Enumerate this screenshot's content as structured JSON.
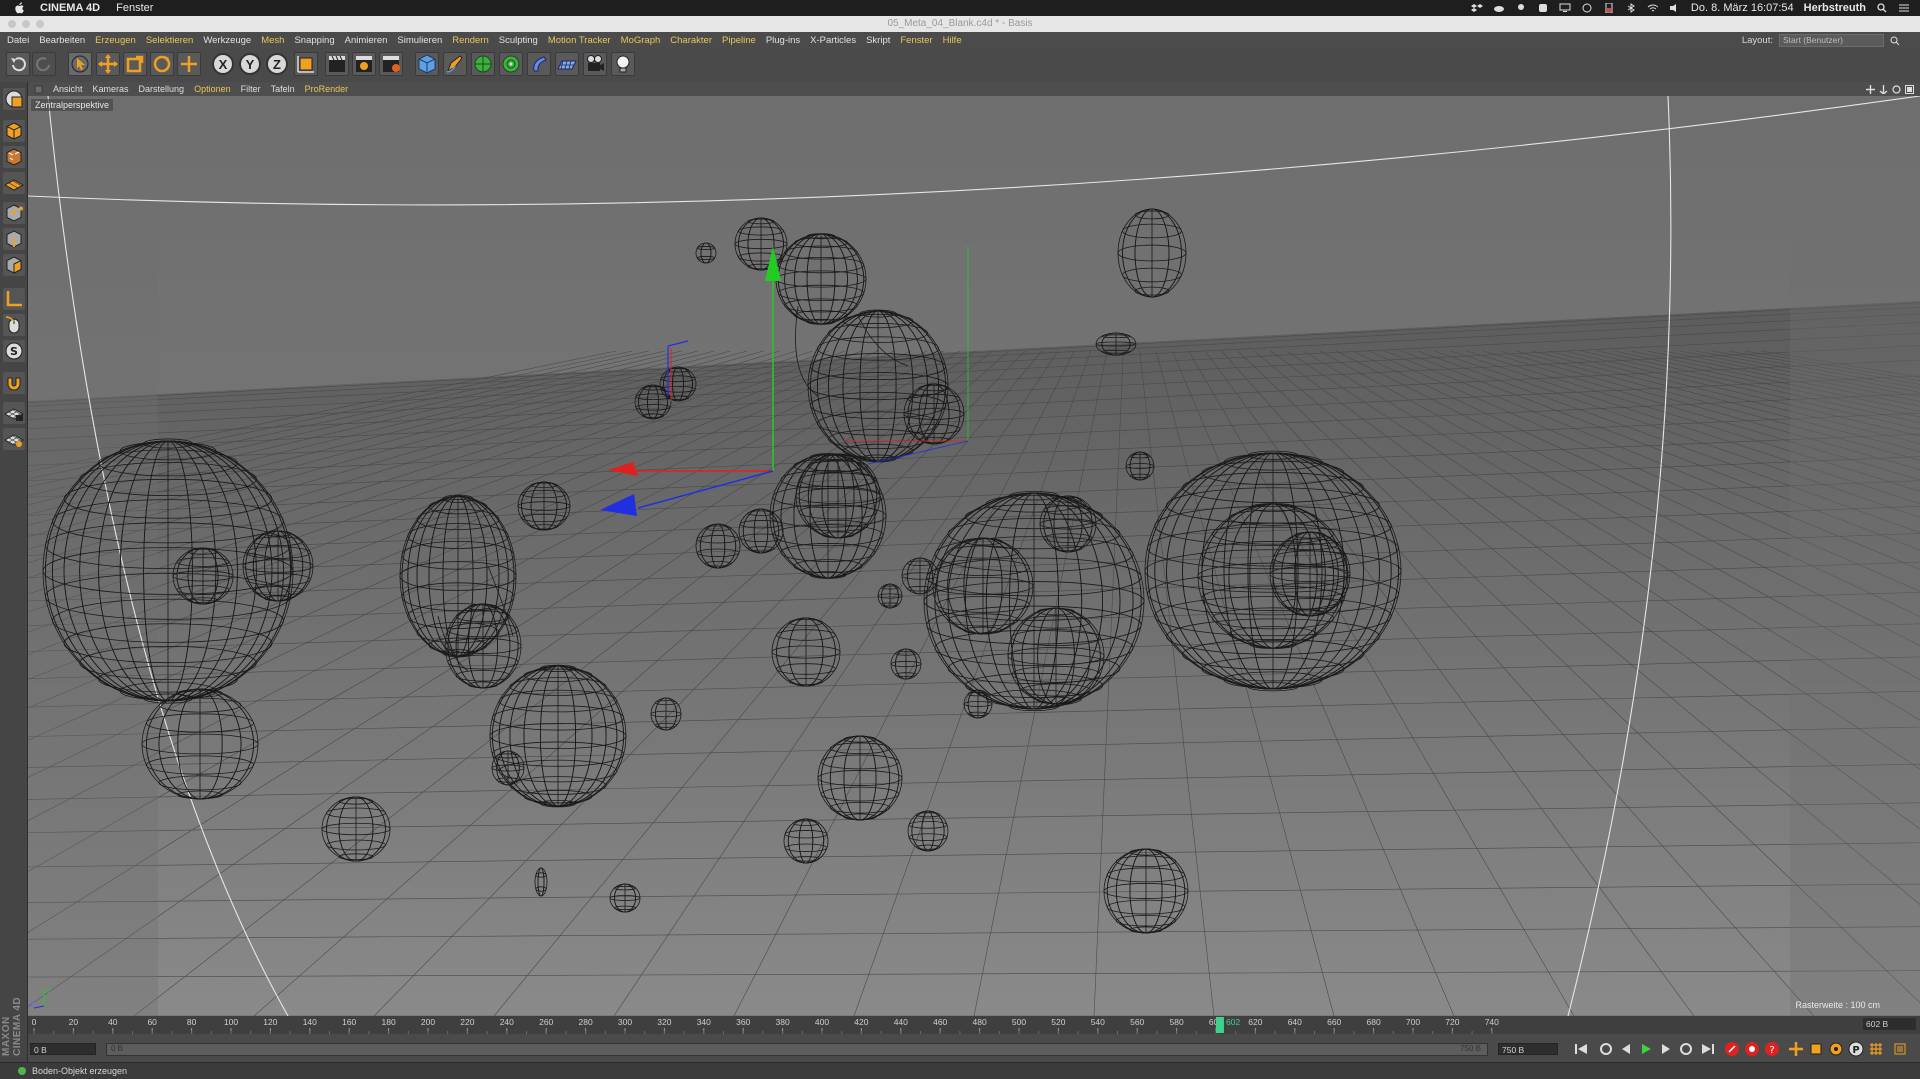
{
  "mac_menubar": {
    "app_name": "CINEMA 4D",
    "menu": "Fenster",
    "clock": "Do. 8. März  16:07:54",
    "user": "Herbstreuth"
  },
  "window": {
    "title": "05_Meta_04_Blank.c4d * - Basis"
  },
  "app_menu": {
    "items": [
      {
        "label": "Datei",
        "highlight": false
      },
      {
        "label": "Bearbeiten",
        "highlight": false
      },
      {
        "label": "Erzeugen",
        "highlight": true
      },
      {
        "label": "Selektieren",
        "highlight": true
      },
      {
        "label": "Werkzeuge",
        "highlight": false
      },
      {
        "label": "Mesh",
        "highlight": true
      },
      {
        "label": "Snapping",
        "highlight": false
      },
      {
        "label": "Animieren",
        "highlight": false
      },
      {
        "label": "Simulieren",
        "highlight": false
      },
      {
        "label": "Rendern",
        "highlight": true
      },
      {
        "label": "Sculpting",
        "highlight": false
      },
      {
        "label": "Motion Tracker",
        "highlight": true
      },
      {
        "label": "MoGraph",
        "highlight": true
      },
      {
        "label": "Charakter",
        "highlight": true
      },
      {
        "label": "Pipeline",
        "highlight": true
      },
      {
        "label": "Plug-ins",
        "highlight": false
      },
      {
        "label": "X-Particles",
        "highlight": false
      },
      {
        "label": "Skript",
        "highlight": false
      },
      {
        "label": "Fenster",
        "highlight": true
      },
      {
        "label": "Hilfe",
        "highlight": true
      }
    ],
    "layout_label": "Layout:",
    "layout_value": "Start (Benutzer)"
  },
  "toolbar": {
    "axis_x": "X",
    "axis_y": "Y",
    "axis_z": "Z"
  },
  "viewport_menu": {
    "items": [
      {
        "label": "Ansicht",
        "highlight": false
      },
      {
        "label": "Kameras",
        "highlight": false
      },
      {
        "label": "Darstellung",
        "highlight": false
      },
      {
        "label": "Optionen",
        "highlight": true
      },
      {
        "label": "Filter",
        "highlight": false
      },
      {
        "label": "Tafeln",
        "highlight": false
      },
      {
        "label": "ProRender",
        "highlight": true
      }
    ]
  },
  "viewport": {
    "view_name": "Zentralperspektive",
    "grid_size": "Rasterweite : 100 cm",
    "axis_gizmo_y": "Y",
    "axis_gizmo_z": "Z"
  },
  "timeline": {
    "ticks": [
      "0",
      "20",
      "40",
      "60",
      "80",
      "100",
      "120",
      "140",
      "160",
      "180",
      "200",
      "220",
      "240",
      "260",
      "280",
      "300",
      "320",
      "340",
      "360",
      "380",
      "400",
      "420",
      "440",
      "460",
      "480",
      "500",
      "520",
      "540",
      "560",
      "580",
      "600",
      "620",
      "640",
      "660",
      "680",
      "700",
      "720",
      "740"
    ],
    "current_frame": 602,
    "current_frame_label": "602",
    "max_frame": 750,
    "end_display": "602 B"
  },
  "transport": {
    "start_field": "0 B",
    "range_start": "0 B",
    "range_end": "750 B",
    "end_field": "750 B"
  },
  "status_bar": {
    "message": "Boden-Objekt erzeugen"
  },
  "brand": {
    "logo_text": "MAXON CINEMA 4D"
  },
  "colors": {
    "menu_highlight": "#e7c75a",
    "axis_x": "#e02020",
    "axis_y": "#22cc22",
    "axis_z": "#2030e0",
    "wire": "#1a1a1a",
    "playhead": "#3fd28a"
  }
}
